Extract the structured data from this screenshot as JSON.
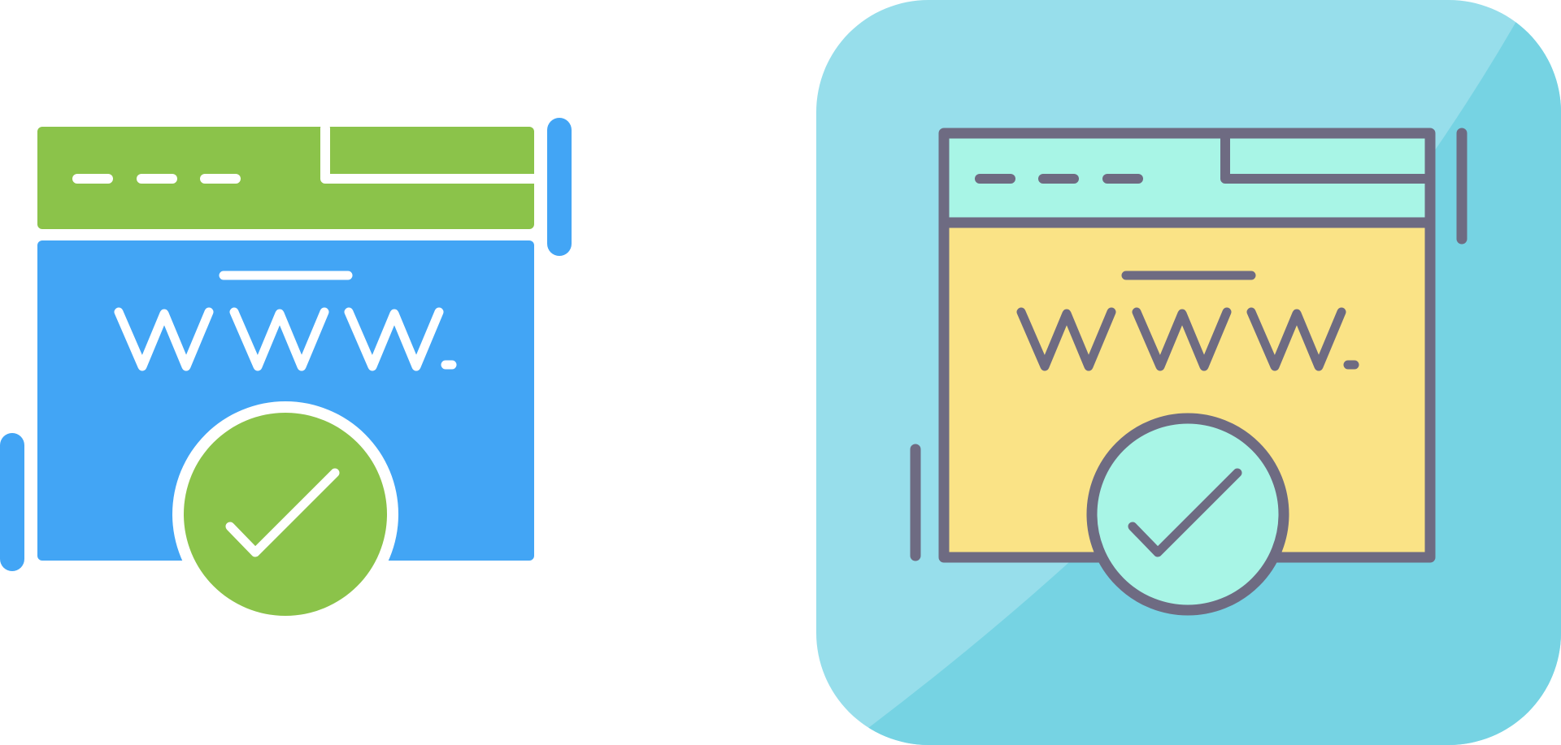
{
  "icons": [
    {
      "name": "website-verified-flat",
      "style": "flat",
      "colors": {
        "header": "#8BC34A",
        "body": "#42A5F5",
        "badge": "#8BC34A",
        "lines": "#FFFFFF",
        "accent": "#42A5F5"
      }
    },
    {
      "name": "website-verified-filled-outline",
      "style": "filled-outline",
      "colors": {
        "tile_light": "#97DEEB",
        "tile_dark": "#76D3E3",
        "header": "#A8F5E6",
        "body": "#FAE386",
        "badge": "#A8F5E6",
        "lines": "#6E6B82"
      }
    }
  ]
}
